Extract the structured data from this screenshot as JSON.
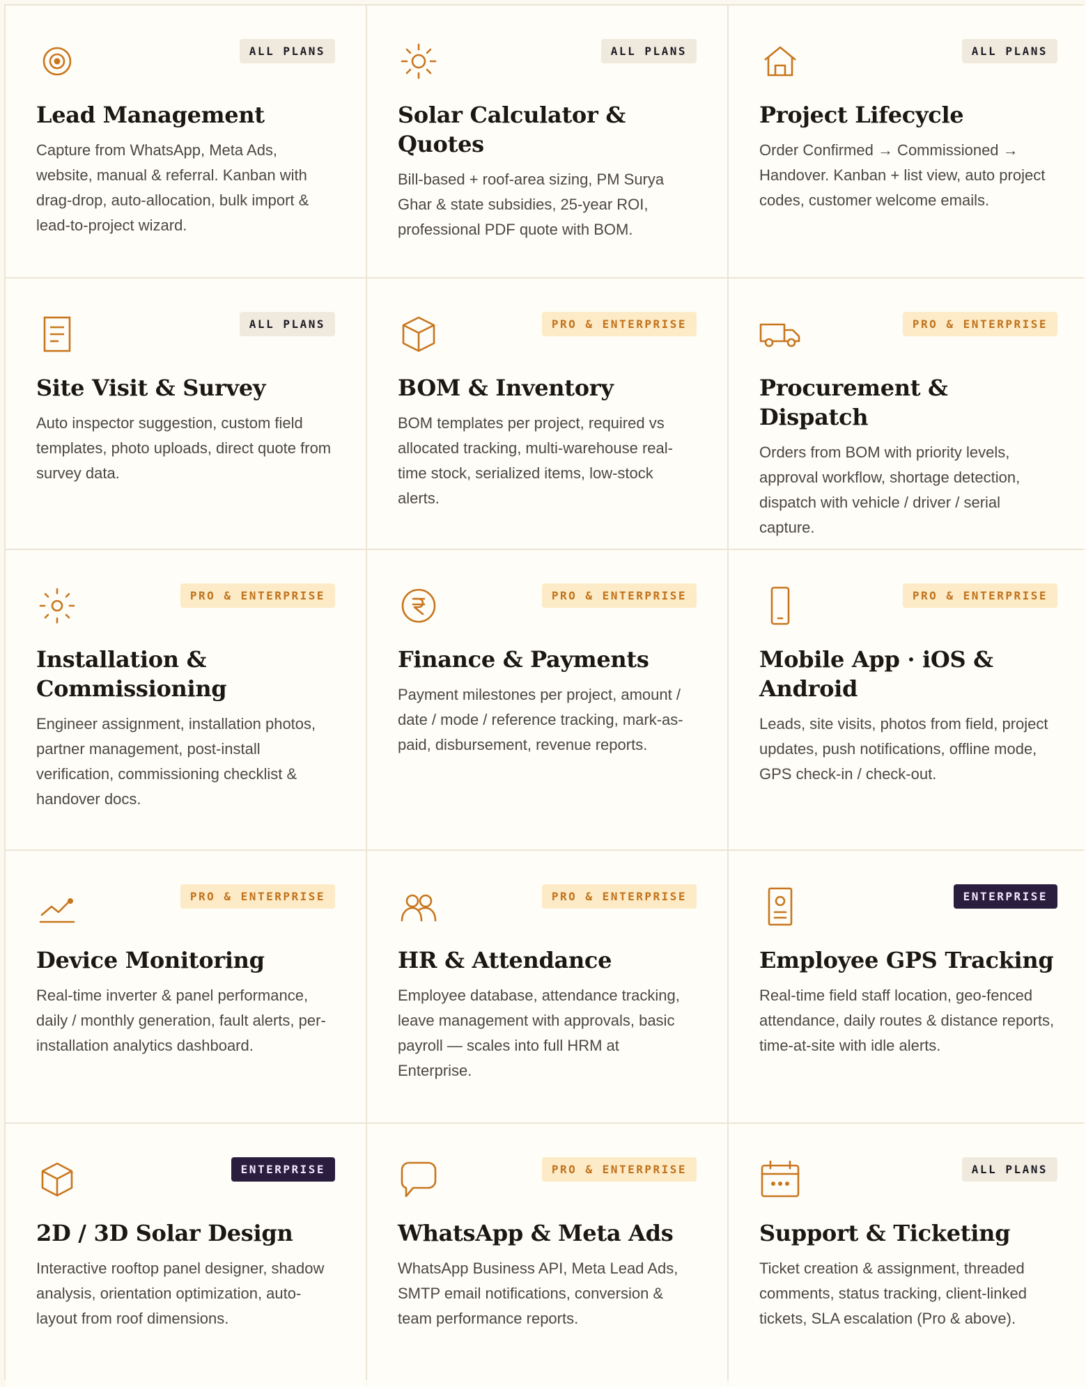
{
  "badges": {
    "all": "ALL PLANS",
    "pro": "PRO & ENTERPRISE",
    "ent": "ENTERPRISE"
  },
  "colors": {
    "accent": "#c7761e",
    "enterprise_bg": "#2a1d3d"
  },
  "cards": [
    {
      "icon": "target-icon",
      "badge": "ALL PLANS",
      "title": "Lead Management",
      "desc": "Capture from WhatsApp, Meta Ads, website, manual & referral. Kanban with drag-drop, auto-allocation, bulk import & lead-to-project wizard."
    },
    {
      "icon": "sun-icon",
      "badge": "ALL PLANS",
      "title": "Solar Calculator & Quotes",
      "desc": "Bill-based + roof-area sizing, PM Surya Ghar & state subsidies, 25-year ROI, professional PDF quote with BOM."
    },
    {
      "icon": "house-icon",
      "badge": "ALL PLANS",
      "title": "Project Lifecycle",
      "desc": "Order Confirmed → Commissioned → Handover. Kanban + list view, auto project codes, customer welcome emails."
    },
    {
      "icon": "document-icon",
      "badge": "ALL PLANS",
      "title": "Site Visit & Survey",
      "desc": "Auto inspector suggestion, custom field templates, photo uploads, direct quote from survey data."
    },
    {
      "icon": "box-icon",
      "badge": "PRO & ENTERPRISE",
      "title": "BOM & Inventory",
      "desc": "BOM templates per project, required vs allocated tracking, multi-warehouse real-time stock, serialized items, low-stock alerts."
    },
    {
      "icon": "truck-icon",
      "badge": "PRO & ENTERPRISE",
      "title": "Procurement & Dispatch",
      "desc": "Orders from BOM with priority levels, approval workflow, shortage detection, dispatch with vehicle / driver / serial capture."
    },
    {
      "icon": "sun-rays-icon",
      "badge": "PRO & ENTERPRISE",
      "title": "Installation & Commissioning",
      "desc": "Engineer assignment, installation photos, partner management, post-install verification, commissioning checklist & handover docs."
    },
    {
      "icon": "rupee-coin-icon",
      "badge": "PRO & ENTERPRISE",
      "title": "Finance & Payments",
      "desc": "Payment milestones per project, amount / date / mode / reference tracking, mark-as-paid, disbursement, revenue reports."
    },
    {
      "icon": "phone-icon",
      "badge": "PRO & ENTERPRISE",
      "title": "Mobile App · iOS & Android",
      "desc": "Leads, site visits, photos from field, project updates, push notifications, offline mode, GPS check-in / check-out."
    },
    {
      "icon": "trend-chart-icon",
      "badge": "PRO & ENTERPRISE",
      "title": "Device Monitoring",
      "desc": "Real-time inverter & panel performance, daily / monthly generation, fault alerts, per-installation analytics dashboard."
    },
    {
      "icon": "users-icon",
      "badge": "PRO & ENTERPRISE",
      "title": "HR & Attendance",
      "desc": "Employee database, attendance tracking, leave management with approvals, basic payroll — scales into full HRM at Enterprise."
    },
    {
      "icon": "id-badge-icon",
      "badge": "ENTERPRISE",
      "title": "Employee GPS Tracking",
      "desc": "Real-time field staff location, geo-fenced attendance, daily routes & distance reports, time-at-site with idle alerts."
    },
    {
      "icon": "cube-icon",
      "badge": "ENTERPRISE",
      "title": "2D / 3D Solar Design",
      "desc": "Interactive rooftop panel designer, shadow analysis, orientation optimization, auto-layout from roof dimensions."
    },
    {
      "icon": "chat-bubble-icon",
      "badge": "PRO & ENTERPRISE",
      "title": "WhatsApp & Meta Ads",
      "desc": "WhatsApp Business API, Meta Lead Ads, SMTP email notifications, conversion & team performance reports."
    },
    {
      "icon": "calendar-icon",
      "badge": "ALL PLANS",
      "title": "Support & Ticketing",
      "desc": "Ticket creation & assignment, threaded comments, status tracking, client-linked tickets, SLA escalation (Pro & above)."
    }
  ]
}
